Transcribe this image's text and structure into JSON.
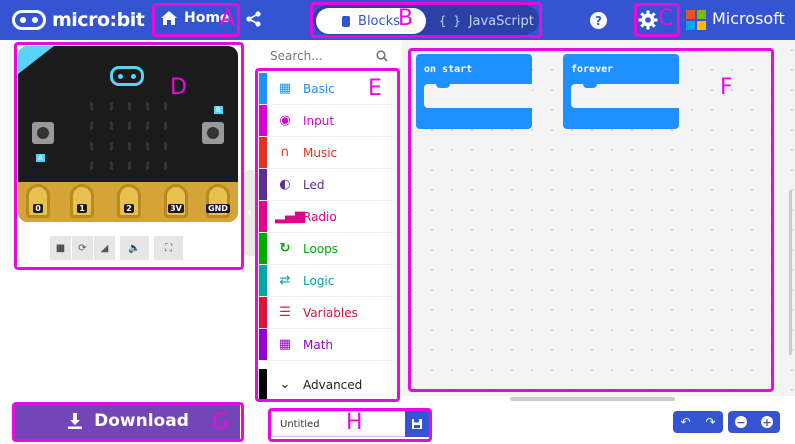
{
  "header": {
    "logo_text": "micro:bit",
    "home_label": "Home",
    "blocks_label": "Blocks",
    "javascript_label": "JavaScript",
    "help_label": "?",
    "brand_text": "Microsoft"
  },
  "annotations": {
    "a": "A",
    "b": "B",
    "c": "C",
    "d": "D",
    "e": "E",
    "f": "F",
    "g": "G",
    "h": "H"
  },
  "simulator": {
    "pin_labels": [
      "0",
      "1",
      "2",
      "3V",
      "GND"
    ],
    "button_a_label": "A",
    "button_b_label": "B"
  },
  "toolbox": {
    "search_placeholder": "Search...",
    "categories": [
      {
        "label": "Basic",
        "color": "#1e90ff",
        "icon": "grid-icon"
      },
      {
        "label": "Input",
        "color": "#d400d4",
        "icon": "target-icon"
      },
      {
        "label": "Music",
        "color": "#e63022",
        "icon": "headphones-icon"
      },
      {
        "label": "Led",
        "color": "#5c2d91",
        "icon": "toggle-icon"
      },
      {
        "label": "Radio",
        "color": "#e3008c",
        "icon": "signal-bars-icon"
      },
      {
        "label": "Loops",
        "color": "#00aa00",
        "icon": "refresh-icon"
      },
      {
        "label": "Logic",
        "color": "#00a4a6",
        "icon": "shuffle-icon"
      },
      {
        "label": "Variables",
        "color": "#dc143c",
        "icon": "lines-icon"
      },
      {
        "label": "Math",
        "color": "#9400d3",
        "icon": "calculator-icon"
      },
      {
        "label": "Advanced",
        "color": "#000000",
        "icon": "chevron-down-icon"
      }
    ]
  },
  "workspace": {
    "blocks": [
      {
        "label": "on start"
      },
      {
        "label": "forever"
      }
    ]
  },
  "bottom": {
    "download_label": "Download",
    "project_name": "Untitled"
  }
}
